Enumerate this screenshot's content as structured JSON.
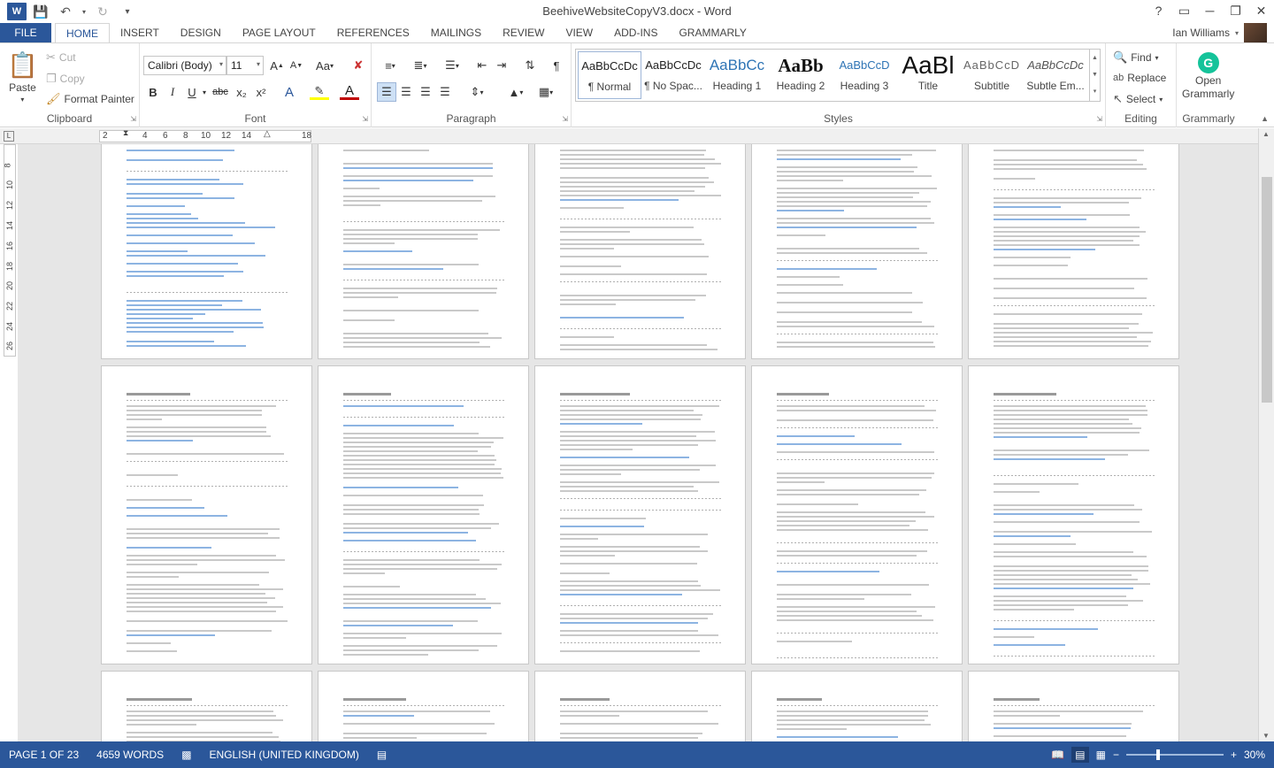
{
  "window": {
    "title": "BeehiveWebsiteCopyV3.docx - Word",
    "help": "?",
    "controls": [
      "▭",
      "─",
      "❐",
      "✕"
    ]
  },
  "qat": {
    "app_logo": "W",
    "icons": [
      "save-icon",
      "undo-icon",
      "redo-icon",
      "customize-icon"
    ]
  },
  "tabs": [
    "FILE",
    "HOME",
    "INSERT",
    "DESIGN",
    "PAGE LAYOUT",
    "REFERENCES",
    "MAILINGS",
    "REVIEW",
    "VIEW",
    "ADD-INS",
    "GRAMMARLY"
  ],
  "active_tab": "HOME",
  "user": {
    "name": "Ian Williams"
  },
  "clipboard": {
    "label": "Clipboard",
    "paste": "Paste",
    "cut": "Cut",
    "copy": "Copy",
    "format_painter": "Format Painter"
  },
  "font": {
    "label": "Font",
    "family": "Calibri (Body)",
    "size": "11",
    "grow": "A",
    "shrink": "A",
    "case": "Aa",
    "bold": "B",
    "italic": "I",
    "underline": "U",
    "strike": "abc",
    "sub": "x₂",
    "sup": "x²",
    "text_effects": "A",
    "font_color": "A"
  },
  "paragraph": {
    "label": "Paragraph"
  },
  "styles": {
    "label": "Styles",
    "items": [
      {
        "preview": "AaBbCcDc",
        "name": "¶ Normal"
      },
      {
        "preview": "AaBbCcDc",
        "name": "¶ No Spac..."
      },
      {
        "preview": "AaBbCc",
        "name": "Heading 1"
      },
      {
        "preview": "AaBb",
        "name": "Heading 2"
      },
      {
        "preview": "AaBbCcD",
        "name": "Heading 3"
      },
      {
        "preview": "AaBl",
        "name": "Title"
      },
      {
        "preview": "AaBbCcD",
        "name": "Subtitle"
      },
      {
        "preview": "AaBbCcDc",
        "name": "Subtle Em..."
      }
    ]
  },
  "editing": {
    "label": "Editing",
    "find": "Find",
    "replace": "Replace",
    "select": "Select"
  },
  "grammarly": {
    "label": "Grammarly",
    "open_line1": "Open",
    "open_line2": "Grammarly"
  },
  "ruler": {
    "ticks": [
      "2",
      "2",
      "4",
      "6",
      "8",
      "10",
      "12",
      "14",
      "",
      "18"
    ]
  },
  "vruler": {
    "ticks": [
      "8",
      "10",
      "12",
      "14",
      "16",
      "18",
      "20",
      "22",
      "24",
      "26"
    ]
  },
  "status": {
    "page": "PAGE 1 OF 23",
    "words": "4659 WORDS",
    "language": "ENGLISH (UNITED KINGDOM)",
    "zoom": "30%"
  }
}
